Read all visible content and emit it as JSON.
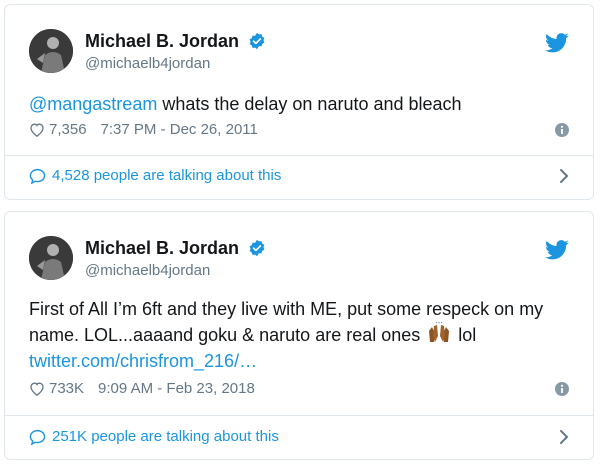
{
  "tweets": [
    {
      "name": "Michael B. Jordan",
      "handle": "@michaelb4jordan",
      "mention": "@mangastream",
      "text": " whats the delay on naruto and bleach",
      "likes": "7,356",
      "timestamp": "7:37 PM - Dec 26, 2011",
      "talking": "4,528 people are talking about this",
      "icons": {
        "avatar": "avatar",
        "verified": "verified-badge-icon",
        "bird": "twitter-bird-icon",
        "heart": "heart-icon",
        "info": "info-icon",
        "bubble": "comment-bubble-icon",
        "chevron": "chevron-right-icon"
      }
    },
    {
      "name": "Michael B. Jordan",
      "handle": "@michaelb4jordan",
      "text_line1": "First of All I’m 6ft and they live with ME, put some respeck on my",
      "text_line2_a": "name. LOL...aaaand goku & naruto are real ones",
      "text_line2_b": "lol",
      "link": "twitter.com/chrisfrom_216/…",
      "likes": "733K",
      "timestamp": "9:09 AM - Feb 23, 2018",
      "talking": "251K people are talking about this",
      "emoji": "raising-hands-emoji"
    }
  ],
  "colors": {
    "accent": "#1b95e0",
    "muted": "#657786",
    "text": "#14171a",
    "border": "#e1e8ed"
  }
}
